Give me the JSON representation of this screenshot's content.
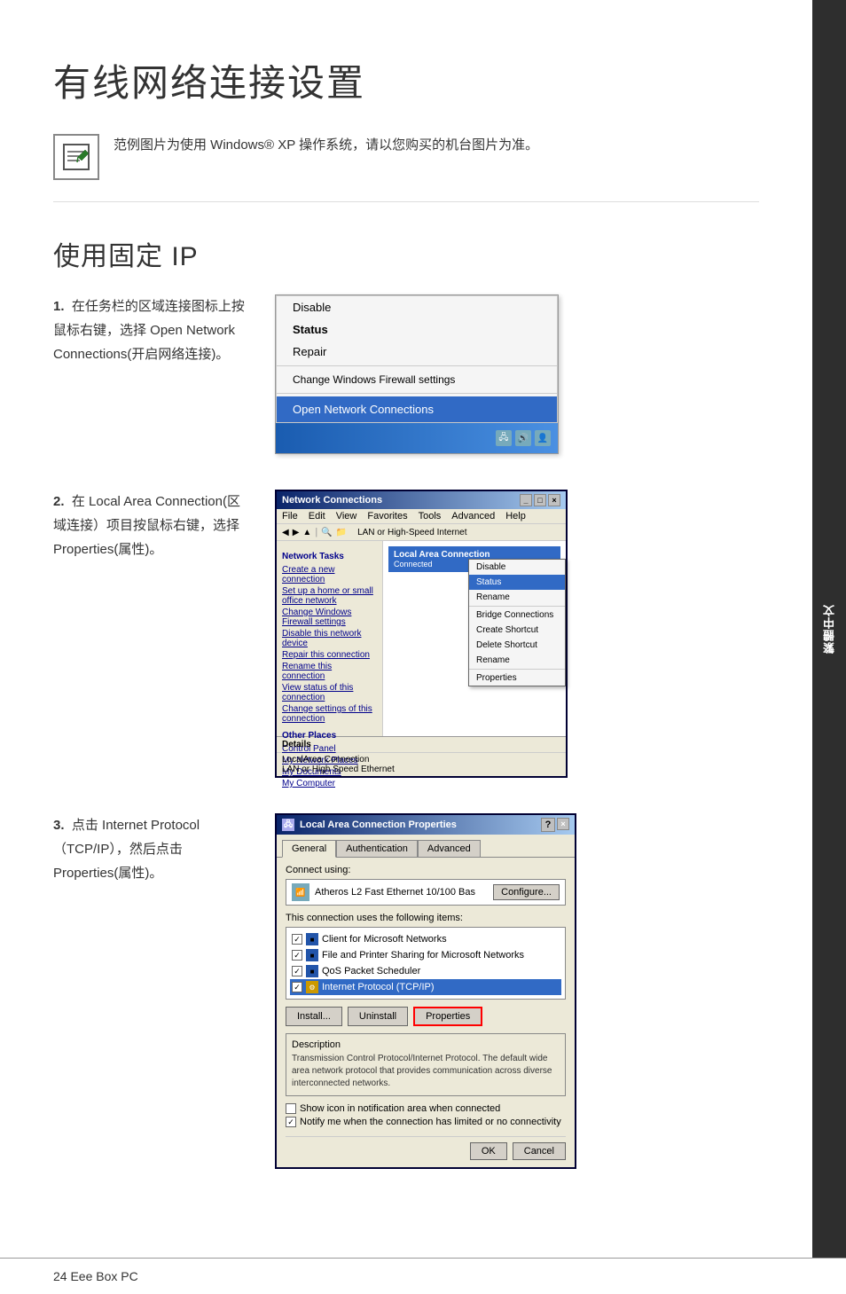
{
  "page": {
    "title": "有线网络连接设置",
    "note_text": "范例图片为使用 Windows® XP 操作系统，请以您购买的机台图片为准。",
    "section_title": "使用固定 IP",
    "footer_text": "24   Eee Box PC",
    "side_tab_label": "繁體中文"
  },
  "steps": [
    {
      "number": "1.",
      "description": "在任务栏的区域连接图标上按鼠标右键，选择 Open Network Connections(开启网络连接)。"
    },
    {
      "number": "2.",
      "description": "在 Local Area Connection(区域连接）项目按鼠标右键，选择 Properties(属性)。"
    },
    {
      "number": "3.",
      "description": "点击 Internet Protocol（TCP/IP），然后点击 Properties(属性)。"
    }
  ],
  "context_menu": {
    "item_disable": "Disable",
    "item_status": "Status",
    "item_repair": "Repair",
    "item_change_fw": "Change Windows Firewall settings",
    "item_open_nc": "Open Network Connections"
  },
  "network_connections_window": {
    "title": "Network Connections",
    "menu_items": [
      "File",
      "Edit",
      "View",
      "Favorites",
      "Tools",
      "Advanced",
      "Help"
    ],
    "toolbar_text": "LAN or High-Speed Internet",
    "connection_name": "Local Area Connection",
    "connection_type": "LAN or High-Speed Ethernet",
    "sidebar_sections": {
      "network_tasks": "Network Tasks",
      "tasks": [
        "Create a new connection",
        "Set up a home or small office network",
        "Change Windows Firewall settings",
        "Disable this network device",
        "Repair this connection",
        "Rename this connection",
        "View status of this connection",
        "Change settings of this connection"
      ],
      "other_places": "Other Places",
      "places": [
        "Control Panel",
        "My Network Places",
        "My Documents",
        "My Computer"
      ],
      "details": "Details"
    },
    "ctx_menu": {
      "disable": "Disable",
      "status": "Status",
      "rename": "Rename",
      "bridge": "Bridge Connections",
      "shortcut": "Create Shortcut",
      "delete": "Delete Shortcut",
      "rename2": "Rename",
      "properties": "Properties"
    },
    "status_bar": "LocalArea Connection\nLAN or High Speed Ethernet"
  },
  "properties_dialog": {
    "title": "Local Area Connection Properties",
    "tabs": [
      "General",
      "Authentication",
      "Advanced"
    ],
    "active_tab": "General",
    "connect_using_label": "Connect using:",
    "adapter_name": "Atheros L2 Fast Ethernet 10/100 Bas",
    "configure_btn": "Configure...",
    "items_label": "This connection uses the following items:",
    "items": [
      {
        "label": "Client for Microsoft Networks",
        "checked": true
      },
      {
        "label": "File and Printer Sharing for Microsoft Networks",
        "checked": true
      },
      {
        "label": "QoS Packet Scheduler",
        "checked": true
      },
      {
        "label": "Internet Protocol (TCP/IP)",
        "checked": true,
        "highlighted": true
      }
    ],
    "install_btn": "Install...",
    "uninstall_btn": "Uninstall",
    "properties_btn": "Properties",
    "description_title": "Description",
    "description_text": "Transmission Control Protocol/Internet Protocol. The default wide area network protocol that provides communication across diverse interconnected networks.",
    "show_icon_label": "Show icon in notification area when connected",
    "notify_label": "Notify me when the connection has limited or no connectivity",
    "ok_btn": "OK",
    "cancel_btn": "Cancel"
  }
}
